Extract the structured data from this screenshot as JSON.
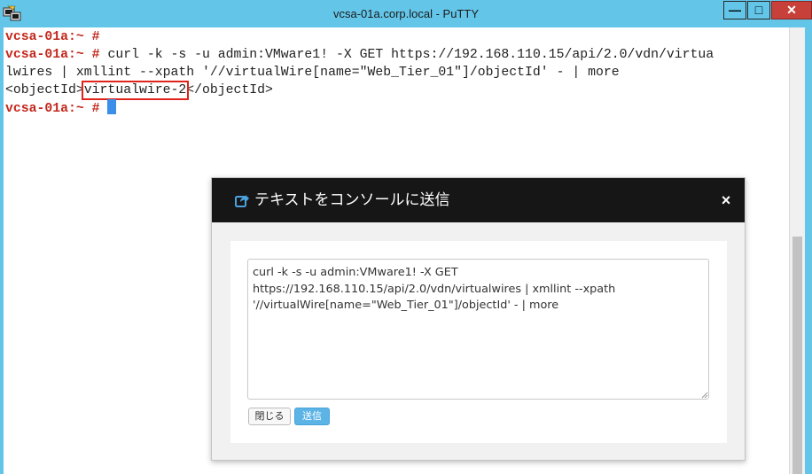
{
  "window": {
    "title": "vcsa-01a.corp.local - PuTTY",
    "minimize_glyph": "—",
    "maximize_glyph": "□",
    "close_glyph": "✕"
  },
  "terminal": {
    "prompt": "vcsa-01a:~ #",
    "command_line1": " curl -k -s -u admin:VMware1! -X GET https://192.168.110.15/api/2.0/vdn/virtua",
    "command_line2": "lwires | xmllint --xpath '//virtualWire[name=\"Web_Tier_01\"]/objectId' - | more",
    "output_open_tag": "<objectId>",
    "output_value": "virtualwire-2",
    "output_close_tag": "</objectId>"
  },
  "dialog": {
    "title": "テキストをコンソールに送信",
    "close_glyph": "×",
    "text_value": "curl -k -s -u admin:VMware1! -X GET https://192.168.110.15/api/2.0/vdn/virtualwires | xmllint --xpath '//virtualWire[name=\"Web_Tier_01\"]/objectId' - | more",
    "close_button": "閉じる",
    "send_button": "送信"
  },
  "icons": {
    "app": "putty-icon",
    "dialog": "share-icon"
  },
  "colors": {
    "titlebar": "#63c6e9",
    "prompt": "#c3281c",
    "highlight_box": "#e0241b",
    "cursor": "#3b8fe8",
    "dialog_header": "#161616",
    "send_button": "#5bb3e6"
  }
}
